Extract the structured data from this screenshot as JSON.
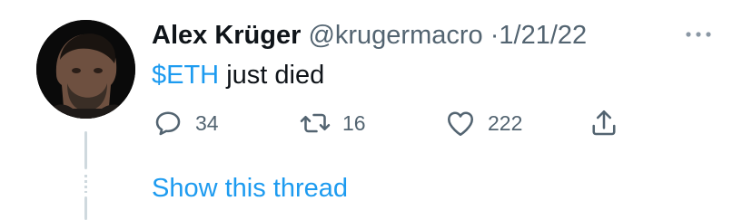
{
  "tweet": {
    "author_name": "Alex Krüger",
    "handle": "@krugermacro",
    "separator": "·",
    "date": "1/21/22",
    "text_cashtag": "$ETH",
    "text_rest": " just died",
    "more_icon": "more-horizontal-icon",
    "avatar_icon": "user-avatar"
  },
  "actions": {
    "reply_count": "34",
    "retweet_count": "16",
    "like_count": "222",
    "reply_icon": "reply-icon",
    "retweet_icon": "retweet-icon",
    "like_icon": "heart-icon",
    "share_icon": "share-icon"
  },
  "thread": {
    "show_label": "Show this thread"
  },
  "colors": {
    "accent": "#1d9bf0",
    "secondary_text": "#536471",
    "primary_text": "#0f1419",
    "thread_line": "#cfd9de"
  }
}
